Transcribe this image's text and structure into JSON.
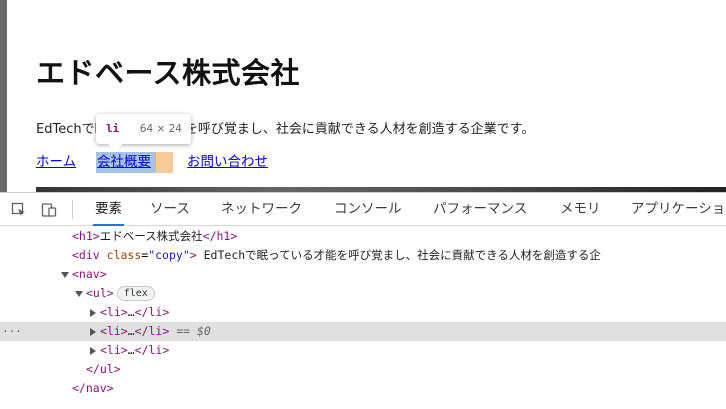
{
  "page": {
    "title": "エドベース株式会社",
    "copy": "EdTechで眠っている才能を呼び覚まし、社会に貢献できる人材を創造する企業です。",
    "nav": [
      {
        "label": "ホーム"
      },
      {
        "label": "会社概要"
      },
      {
        "label": "お問い合わせ"
      }
    ]
  },
  "tooltip": {
    "tag": "li",
    "dimensions": "64 × 24"
  },
  "devtools": {
    "tabs": [
      "要素",
      "ソース",
      "ネットワーク",
      "コンソール",
      "パフォーマンス",
      "メモリ",
      "アプリケーショ"
    ],
    "active_tab": "要素",
    "tree": {
      "h1_open": "<h1>",
      "h1_text": "エドベース株式会社",
      "h1_close": "</h1>",
      "div_open": "<div",
      "div_attr_name": "class",
      "div_attr_value": "\"copy\"",
      "div_text": "EdTechで眠っている才能を呼び覚まし、社会に貢献できる人材を創造する企",
      "nav_open": "<nav>",
      "ul_open": "<ul>",
      "ul_badge": "flex",
      "li_open": "<li>",
      "li_ellipsis": "…",
      "li_close": "</li>",
      "selected_marker": "== $0",
      "ul_close": "</ul>",
      "nav_close": "</nav>",
      "row_dots": "···"
    }
  },
  "colors": {
    "tag": "#881280",
    "attr_name": "#994500",
    "attr_value": "#1a1aa6",
    "link": "#0000ee",
    "active_tab_underline": "#1a73e8",
    "highlight_content": "#a4c4e7",
    "highlight_margin": "#f5cb9a"
  },
  "icons": [
    "inspect-element-icon",
    "device-toggle-icon"
  ]
}
